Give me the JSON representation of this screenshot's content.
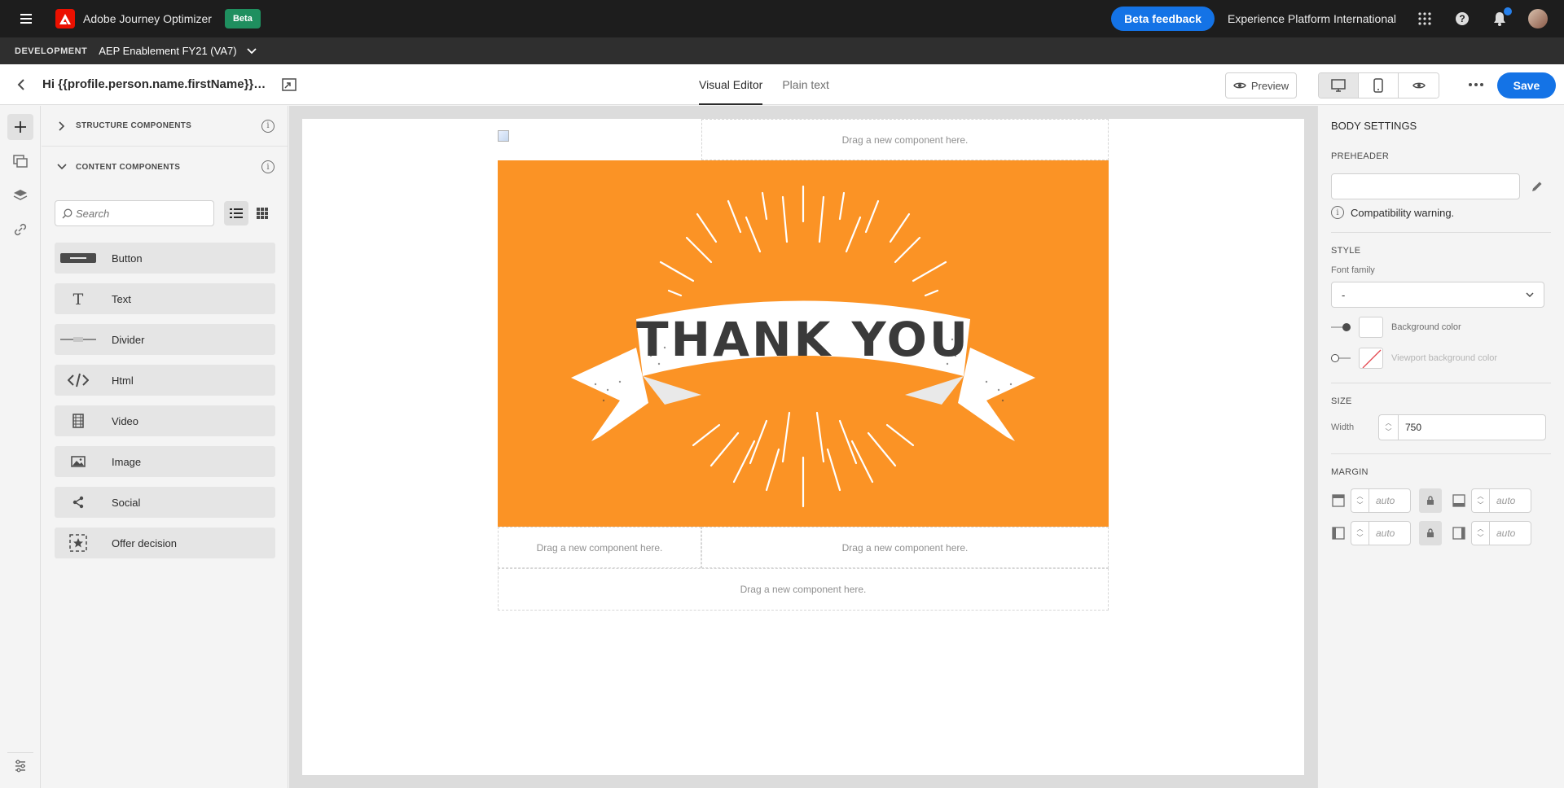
{
  "topbar": {
    "app_title": "Adobe Journey Optimizer",
    "beta_badge": "Beta",
    "beta_feedback": "Beta feedback",
    "org_name": "Experience Platform International"
  },
  "sandbox": {
    "env_label": "DEVELOPMENT",
    "name": "AEP Enablement FY21 (VA7)"
  },
  "editor": {
    "email_title": "Hi {{profile.person.name.firstName}},than...",
    "tabs": [
      "Visual Editor",
      "Plain text"
    ],
    "active_tab": "Visual Editor",
    "preview_label": "Preview",
    "save_label": "Save",
    "active_device": "desktop"
  },
  "components": {
    "structure_title": "STRUCTURE COMPONENTS",
    "content_title": "CONTENT COMPONENTS",
    "search_placeholder": "Search",
    "items": [
      {
        "label": "Button",
        "icon": "button-icon"
      },
      {
        "label": "Text",
        "icon": "text-icon"
      },
      {
        "label": "Divider",
        "icon": "divider-icon"
      },
      {
        "label": "Html",
        "icon": "html-icon"
      },
      {
        "label": "Video",
        "icon": "video-icon"
      },
      {
        "label": "Image",
        "icon": "image-icon"
      },
      {
        "label": "Social",
        "icon": "share-icon"
      },
      {
        "label": "Offer decision",
        "icon": "offer-decision-icon"
      }
    ]
  },
  "canvas": {
    "drop_hint": "Drag a new component here.",
    "hero_text": "THANK YOU",
    "hero_color": "#fb9325"
  },
  "body_settings": {
    "title": "BODY SETTINGS",
    "preheader_label": "PREHEADER",
    "preheader_value": "",
    "compat_warning": "Compatibility warning.",
    "style_label": "STYLE",
    "font_family_label": "Font family",
    "font_family_value": "-",
    "background_color_label": "Background color",
    "viewport_bg_label": "Viewport background color",
    "size_label": "SIZE",
    "width_label": "Width",
    "width_value": "750",
    "margin_label": "MARGIN",
    "margin_top": "auto",
    "margin_bottom": "auto",
    "margin_left": "auto",
    "margin_right": "auto"
  },
  "colors": {
    "accent": "#1473e6",
    "beta_badge": "#1f8f5f",
    "topbar": "#1d1d1d"
  }
}
